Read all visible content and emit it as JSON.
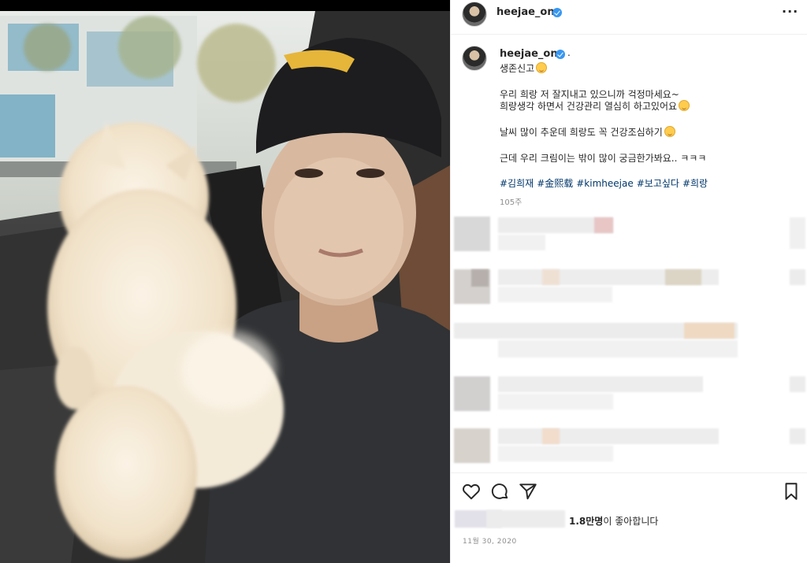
{
  "post": {
    "username": "heejae_one",
    "caption_dot": ".",
    "caption_lines": [
      "생존신고",
      "우리 희랑 저 잘지내고 있으니까 걱정마세요~",
      "희랑생각 하면서 건강관리 열심히 하고있어요",
      "날씨 많이 추운데 희랑도 꼭 건강조심하기",
      "근데 우리 크림이는 밖이 많이 궁금한가봐요.. ㅋㅋㅋ"
    ],
    "hashtags": [
      "#김희재",
      "#金熙载",
      "#kimheejae",
      "#보고싶다",
      "#희랑"
    ],
    "age": "105주",
    "likes_count": "1.8만명",
    "likes_suffix": "이 좋아합니다",
    "date": "11월 30, 2020"
  },
  "icons": {
    "more": "more-options-icon",
    "like": "heart-icon",
    "comment": "comment-icon",
    "share": "send-icon",
    "save": "bookmark-icon",
    "verified": "verified-badge-icon"
  },
  "colors": {
    "link": "#00376b",
    "verified": "#3897f0",
    "muted": "#8e8e8e"
  }
}
